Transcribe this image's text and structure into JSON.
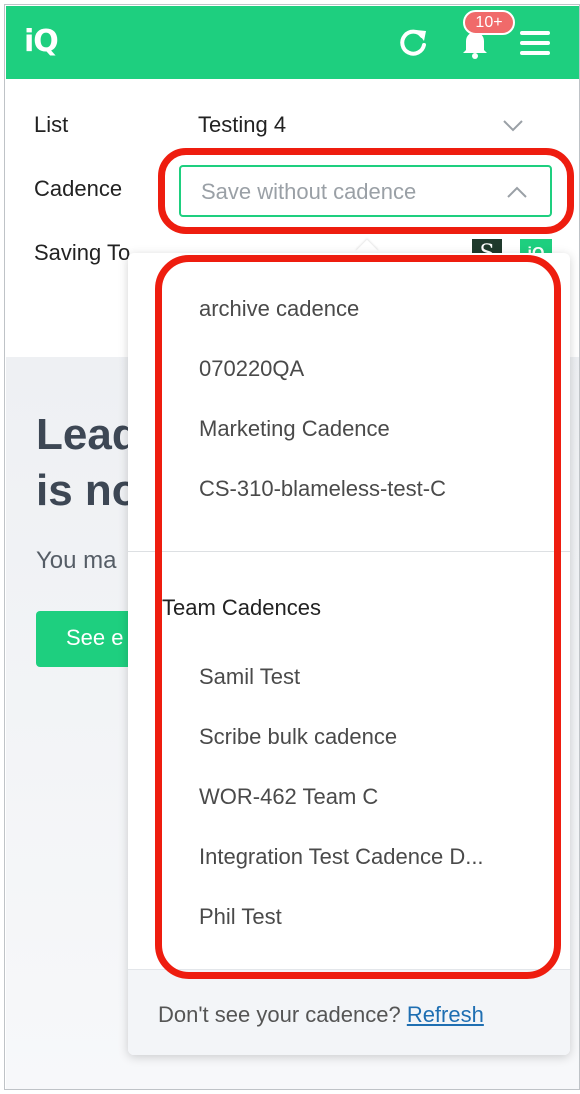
{
  "header": {
    "logo_text": "iQ",
    "notification_badge": "10+",
    "icons": [
      "refresh-icon",
      "bell-icon",
      "menu-icon"
    ],
    "color": "#1ecf7f"
  },
  "form": {
    "list_label": "List",
    "list_value": "Testing 4",
    "cadence_label": "Cadence",
    "cadence_placeholder": "Save without cadence",
    "saving_to_label": "Saving To",
    "crm_icon_letter": "S",
    "iq_icon_text": "iQ"
  },
  "background": {
    "heading_line1": "Lead",
    "heading_line2": "is no",
    "subtext": "You ma",
    "button_label": "See e"
  },
  "dropdown": {
    "personal_items": [
      "archive cadence",
      "070220QA",
      "Marketing Cadence",
      "CS-310-blameless-test-C"
    ],
    "team_group_label": "Team Cadences",
    "team_items": [
      "Samil Test",
      "Scribe bulk cadence",
      "WOR-462 Team C",
      "Integration Test Cadence D...",
      "Phil Test"
    ],
    "footer_text": "Don't see your cadence? ",
    "footer_link": "Refresh"
  },
  "highlight_color": "#ee1d0f"
}
